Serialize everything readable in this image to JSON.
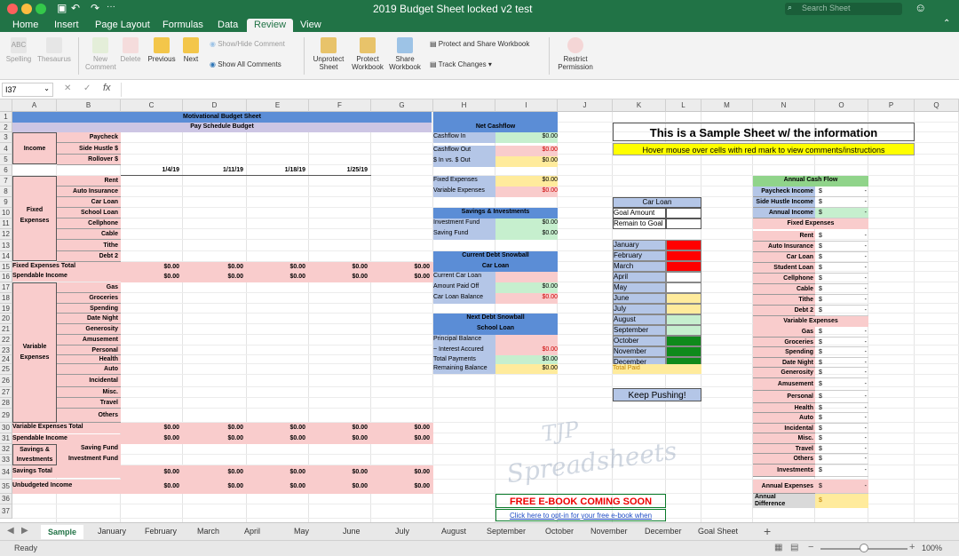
{
  "window": {
    "title": "2019 Budget Sheet locked v2 test",
    "search_placeholder": "Search Sheet"
  },
  "menu_tabs": [
    "Home",
    "Insert",
    "Page Layout",
    "Formulas",
    "Data",
    "Review",
    "View"
  ],
  "ribbon": {
    "spelling": "Spelling",
    "thesaurus": "Thesaurus",
    "new_comment": "New\nComment",
    "delete": "Delete",
    "previous": "Previous",
    "next": "Next",
    "show_hide_comment": "Show/Hide Comment",
    "show_all_comments": "Show All Comments",
    "unprotect_sheet": "Unprotect\nSheet",
    "protect_workbook": "Protect\nWorkbook",
    "share_workbook": "Share\nWorkbook",
    "protect_share": "Protect and Share Workbook",
    "track_changes": "Track Changes",
    "restrict_permission": "Restrict\nPermission"
  },
  "formula_bar": {
    "name_box": "I37",
    "fx": "fx",
    "formula": ""
  },
  "columns": [
    "A",
    "B",
    "C",
    "D",
    "E",
    "F",
    "G",
    "H",
    "I",
    "J",
    "K",
    "L",
    "M",
    "N",
    "O",
    "P",
    "Q"
  ],
  "rows": [
    "1",
    "2",
    "3",
    "4",
    "5",
    "6",
    "7",
    "8",
    "9",
    "10",
    "11",
    "12",
    "13",
    "14",
    "15",
    "16",
    "17",
    "18",
    "19",
    "20",
    "21",
    "22",
    "23",
    "24",
    "25",
    "26",
    "27",
    "28",
    "29",
    "30",
    "31",
    "32",
    "33",
    "34",
    "35",
    "36",
    "37"
  ],
  "budget": {
    "title": "Motivational Budget Sheet",
    "pay_schedule": "Pay Schedule Budget",
    "income": "Income",
    "income_items": [
      "Paycheck",
      "Side Hustle $",
      "Rollover $"
    ],
    "dates": [
      "1/4/19",
      "1/11/19",
      "1/18/19",
      "1/25/19"
    ],
    "fixed_expenses": "Fixed\nExpenses",
    "fixed_items": [
      "Rent",
      "Auto Insurance",
      "Car Loan",
      "School Loan",
      "Cellphone",
      "Cable",
      "Tithe",
      "Debt 2"
    ],
    "fixed_total": "Fixed Expenses Total",
    "spendable_income": "Spendable Income",
    "variable_expenses": "Variable\nExpenses",
    "variable_items": [
      "Gas",
      "Groceries",
      "Spending",
      "Date Night",
      "Generosity",
      "Amusement",
      "Personal",
      "Health",
      "Auto",
      "Incidental",
      "Misc.",
      "Travel",
      "Others"
    ],
    "variable_total": "Variable Expenses Total",
    "savings_investments": "Savings &\nInvestments",
    "saving_fund": "Saving Fund",
    "investment_fund": "Investment Fund",
    "savings_total": "Savings Total",
    "unbudgeted": "Unbudgeted Income",
    "zero": "$0.00"
  },
  "net_cashflow": {
    "title": "Net Cashflow",
    "items": [
      "Cashflow In",
      "Cashflow Out",
      "$ In vs. $ Out"
    ],
    "fixed": "Fixed Expenses",
    "variable": "Variable Expenses",
    "savings_title": "Savings & Investments",
    "investment_fund": "Investment Fund",
    "saving_fund": "Saving Fund",
    "current_snowball": "Current Debt Snowball",
    "car_loan": "Car Loan",
    "current_car_loan": "Current Car Loan",
    "amount_paid_off": "Amount Paid Off",
    "car_loan_balance": "Car Loan Balance",
    "next_snowball": "Next Debt Snowball",
    "school_loan": "School Loan",
    "principal_balance": "Principal Balance",
    "interest_accrued": "~ Interest Accured",
    "total_payments": "Total Payments",
    "remaining_balance": "Remaining Balance",
    "zero": "$0.00"
  },
  "sample": {
    "heading": "This is a Sample Sheet w/ the information",
    "hint": "Hover mouse over cells with red mark to view comments/instructions"
  },
  "car_tracker": {
    "title": "Car Loan",
    "goal": "Goal Amount",
    "remain": "Remain to Goal",
    "months": [
      "January",
      "February",
      "March",
      "April",
      "May",
      "June",
      "July",
      "August",
      "September",
      "October",
      "November",
      "December"
    ],
    "total_paid": "Total Paid",
    "colors": [
      "#ff0000",
      "#ff0000",
      "#ff0000",
      "#ffffff",
      "#ffffff",
      "#ffeb9c",
      "#ffeb9c",
      "#c6efce",
      "#c6efce",
      "#0f8a1b",
      "#0f8a1b",
      "#0f8a1b"
    ],
    "keep_pushing": "Keep Pushing!"
  },
  "annual": {
    "title": "Annual Cash Flow",
    "income_items": [
      "Paycheck Income",
      "Side Hustle Income",
      "Annual Income"
    ],
    "fixed_title": "Fixed Expenses",
    "fixed_items": [
      "Rent",
      "Auto Insurance",
      "Car Loan",
      "Student Loan",
      "Cellphone",
      "Cable",
      "Tithe",
      "Debt 2"
    ],
    "variable_title": "Variable Expenses",
    "variable_items": [
      "Gas",
      "Groceries",
      "Spending",
      "Date Night",
      "Generosity",
      "Amusement",
      "Personal",
      "Health",
      "Auto",
      "Incidental",
      "Misc.",
      "Travel",
      "Others",
      "Investments"
    ],
    "annual_expenses": "Annual Expenses",
    "annual_difference": "Annual\nDifference",
    "dollar": "$",
    "dash": "-"
  },
  "watermark": {
    "line1": "TJP",
    "line2": "Spreadsheets"
  },
  "ebook": {
    "title": "FREE E-BOOK COMING SOON",
    "link": "Click here to opt-in for your free e-book when"
  },
  "sheet_tabs": [
    "Sample",
    "January",
    "February",
    "March",
    "April",
    "May",
    "June",
    "July",
    "August",
    "September",
    "October",
    "November",
    "December",
    "Goal Sheet"
  ],
  "status": {
    "ready": "Ready",
    "zoom": "100%"
  }
}
